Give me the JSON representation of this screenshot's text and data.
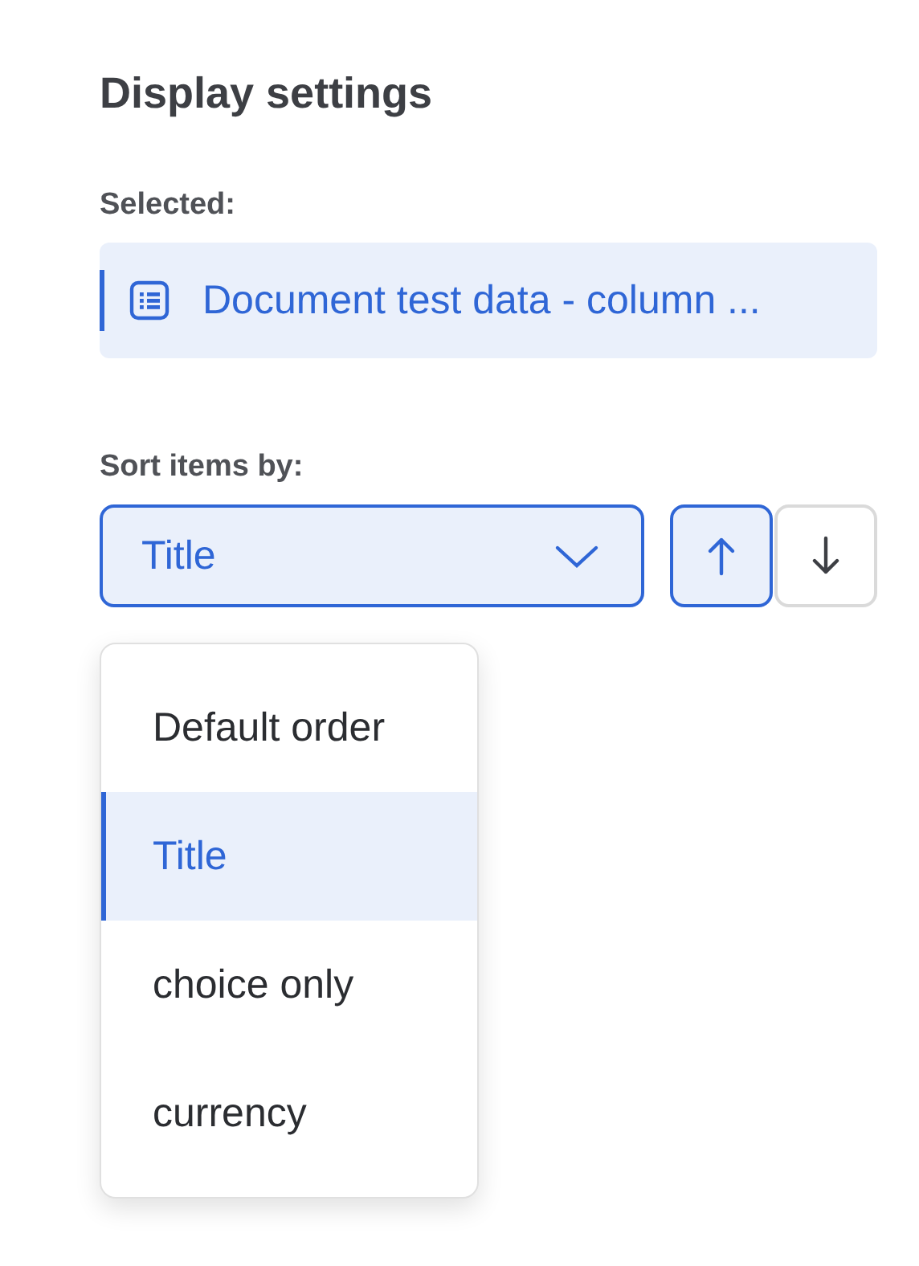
{
  "title": "Display settings",
  "selected_section": {
    "label": "Selected:",
    "item": "Document test data - column ..."
  },
  "sort": {
    "label": "Sort items by:",
    "value": "Title",
    "expanded": true,
    "directions": [
      {
        "kind": "ascending",
        "selected": true
      },
      {
        "kind": "descending",
        "selected": false
      }
    ],
    "options": [
      {
        "label": "Default order",
        "selected": false
      },
      {
        "label": "Title",
        "selected": true
      },
      {
        "label": "choice only",
        "selected": false
      },
      {
        "label": "currency",
        "selected": false
      }
    ]
  }
}
